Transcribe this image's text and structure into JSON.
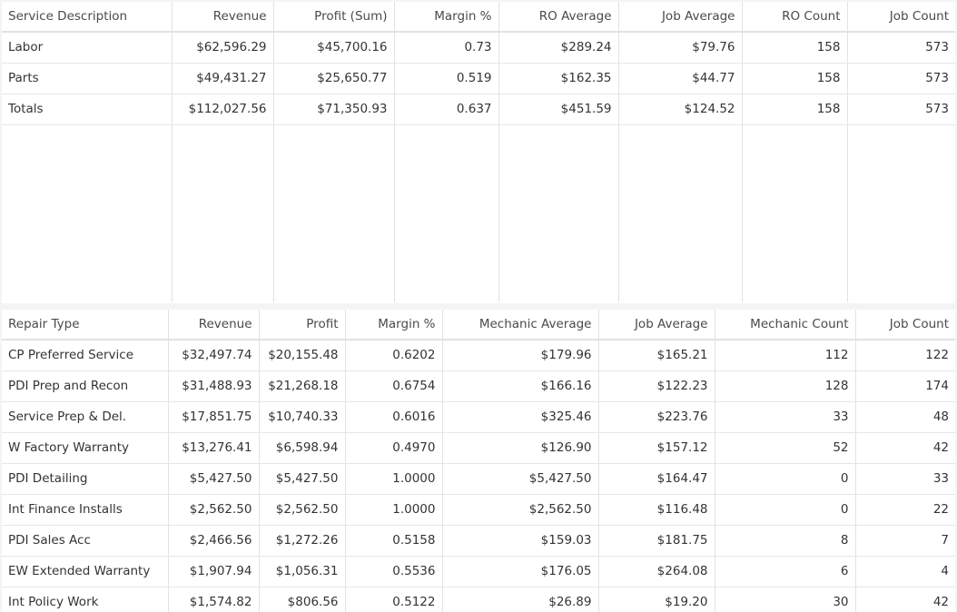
{
  "service_table": {
    "columns": [
      "Service Description",
      "Revenue",
      "Profit (Sum)",
      "Margin %",
      "RO Average",
      "Job Average",
      "RO Count",
      "Job Count"
    ],
    "rows": [
      [
        "Labor",
        "$62,596.29",
        "$45,700.16",
        "0.73",
        "$289.24",
        "$79.76",
        "158",
        "573"
      ],
      [
        "Parts",
        "$49,431.27",
        "$25,650.77",
        "0.519",
        "$162.35",
        "$44.77",
        "158",
        "573"
      ],
      [
        "Totals",
        "$112,027.56",
        "$71,350.93",
        "0.637",
        "$451.59",
        "$124.52",
        "158",
        "573"
      ]
    ]
  },
  "repair_table": {
    "columns": [
      "Repair Type",
      "Revenue",
      "Profit",
      "Margin %",
      "Mechanic Average",
      "Job Average",
      "Mechanic Count",
      "Job Count"
    ],
    "rows": [
      [
        "CP Preferred Service",
        "$32,497.74",
        "$20,155.48",
        "0.6202",
        "$179.96",
        "$165.21",
        "112",
        "122"
      ],
      [
        "PDI Prep and Recon",
        "$31,488.93",
        "$21,268.18",
        "0.6754",
        "$166.16",
        "$122.23",
        "128",
        "174"
      ],
      [
        "Service Prep & Del.",
        "$17,851.75",
        "$10,740.33",
        "0.6016",
        "$325.46",
        "$223.76",
        "33",
        "48"
      ],
      [
        "W Factory Warranty",
        "$13,276.41",
        "$6,598.94",
        "0.4970",
        "$126.90",
        "$157.12",
        "52",
        "42"
      ],
      [
        "PDI Detailing",
        "$5,427.50",
        "$5,427.50",
        "1.0000",
        "$5,427.50",
        "$164.47",
        "0",
        "33"
      ],
      [
        "Int Finance Installs",
        "$2,562.50",
        "$2,562.50",
        "1.0000",
        "$2,562.50",
        "$116.48",
        "0",
        "22"
      ],
      [
        "PDI Sales Acc",
        "$2,466.56",
        "$1,272.26",
        "0.5158",
        "$159.03",
        "$181.75",
        "8",
        "7"
      ],
      [
        "EW Extended Warranty",
        "$1,907.94",
        "$1,056.31",
        "0.5536",
        "$176.05",
        "$264.08",
        "6",
        "4"
      ],
      [
        "Int Policy Work",
        "$1,574.82",
        "$806.56",
        "0.5122",
        "$26.89",
        "$19.20",
        "30",
        "42"
      ]
    ]
  }
}
